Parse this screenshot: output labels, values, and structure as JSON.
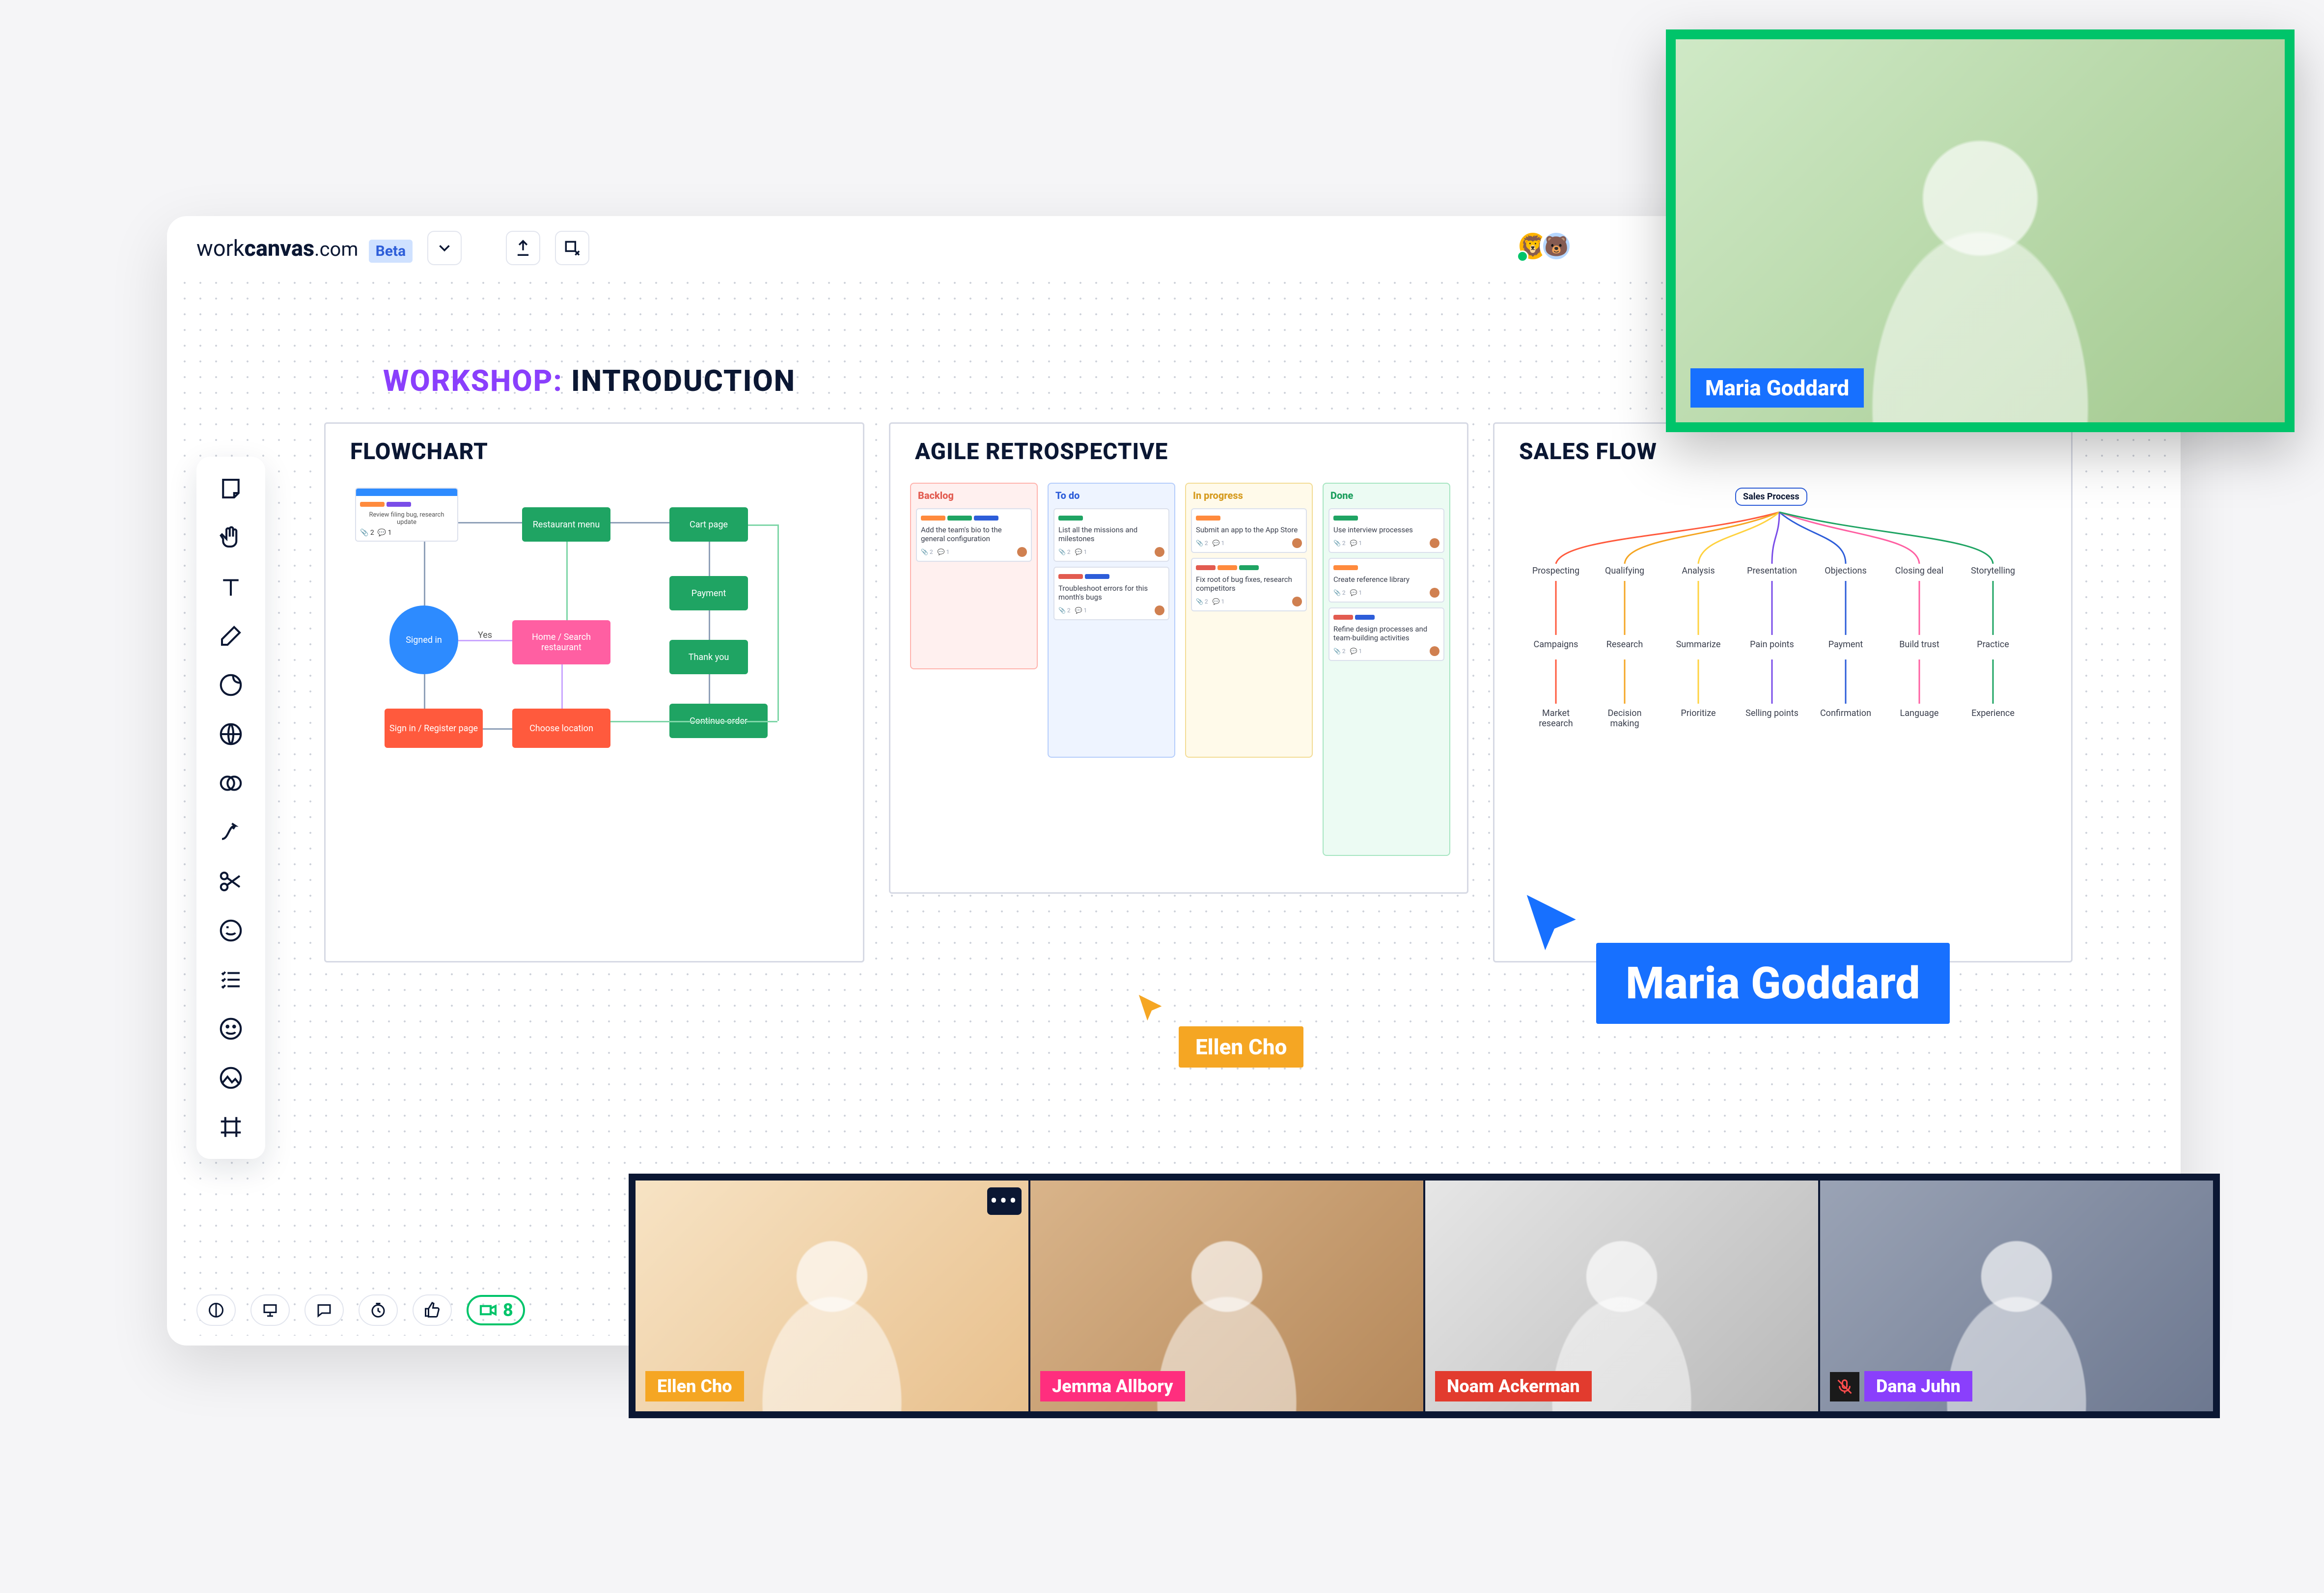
{
  "header": {
    "logo_part1": "work",
    "logo_part2": "canvas",
    "logo_ext": ".com",
    "beta_label": "Beta"
  },
  "canvas": {
    "title_prefix": "WORKSHOP:",
    "title_main": "INTRODUCTION"
  },
  "cards": {
    "flowchart": {
      "title": "FLOWCHART",
      "nodes": {
        "signed_in": "Signed in",
        "restaurant_menu": "Restaurant menu",
        "cart_page": "Cart page",
        "payment": "Payment",
        "thank_you": "Thank you",
        "continue_order": "Continue order",
        "home_search": "Home / Search restaurant",
        "sign_in_register": "Sign in / Register page",
        "choose_location": "Choose location",
        "yes_label": "Yes"
      }
    },
    "agile": {
      "title": "AGILE RETROSPECTIVE",
      "columns": {
        "backlog": "Backlog",
        "todo": "To do",
        "in_progress": "In progress",
        "done": "Done"
      },
      "cards": {
        "c1": "Add the team's bio to the general configuration",
        "c2": "List all the missions and milestones",
        "c3": "Submit an app to the App Store",
        "c4": "Use interview processes",
        "c5": "Troubleshoot errors for this month's bugs",
        "c6": "Fix root of bug fixes, research competitors",
        "c7": "Create reference library",
        "c8": "Refine design processes and team-building activities"
      }
    },
    "sales": {
      "title": "SALES FLOW",
      "root": "Sales Process",
      "level1": [
        "Prospecting",
        "Qualifying",
        "Analysis",
        "Presentation",
        "Objections",
        "Closing deal",
        "Storytelling"
      ],
      "level2": [
        "Campaigns",
        "Research",
        "Summarize",
        "Pain points",
        "Payment",
        "Build trust",
        "Practice"
      ],
      "level3": [
        "Market research",
        "Decision making",
        "Prioritize",
        "Selling points",
        "Confirmation",
        "Language",
        "Experience"
      ]
    }
  },
  "cursors": {
    "ellen": "Ellen Cho",
    "maria": "Maria Goddard"
  },
  "big_video": {
    "name": "Maria Goddard"
  },
  "participants": [
    {
      "name": "Ellen Cho",
      "color": "#f5a623"
    },
    {
      "name": "Jemma Allbory",
      "color": "#ff2e7e"
    },
    {
      "name": "Noam Ackerman",
      "color": "#e23b2e"
    },
    {
      "name": "Dana Juhn",
      "color": "#8a3ffc",
      "muted": true
    }
  ],
  "bottom_cam_count": "8"
}
